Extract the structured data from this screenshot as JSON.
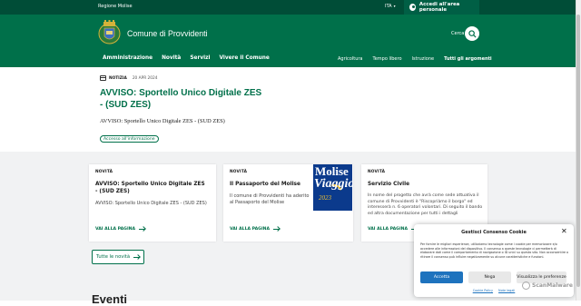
{
  "topbar": {
    "region": "Regione Molise",
    "language": "ITA",
    "login": "Accedi all'area personale"
  },
  "header": {
    "title": "Comune di Provvidenti",
    "search_label": "Cerca"
  },
  "nav": {
    "main": [
      "Amministrazione",
      "Novità",
      "Servizi",
      "Vivere il Comune"
    ],
    "secondary": [
      "Agricoltura",
      "Tempo libero",
      "Istruzione"
    ],
    "all_topics": "Tutti gli argomenti"
  },
  "featured": {
    "type": "NOTIZIA",
    "date": "20 APR 2024",
    "title": "AVVISO: Sportello Unico Digitale ZES - (SUD ZES)",
    "subtitle": "AVVISO: Sportello Unico Digitale ZES - (SUD ZES)",
    "tag": "Accesso all'informazione"
  },
  "cards": [
    {
      "category": "NOVITÀ",
      "title": "AVVISO: Sportello Unico Digitale ZES - (SUD ZES)",
      "text": "AVVISO: Sportello Unico Digitale ZES - (SUD ZES)",
      "link": "VAI ALLA PAGINA"
    },
    {
      "category": "NOVITÀ",
      "title": "Il Passaporto del Molise",
      "text": "Il comune di Provvidenti ha aderito al Passaporto del Molise",
      "link": "VAI ALLA PAGINA",
      "image_text": [
        "Molise",
        "Viaggio",
        "2023"
      ]
    },
    {
      "category": "NOVITÀ",
      "title": "Servizio Civile",
      "text": "In nome del progetto che avrà come sede attuativa il comune di Provvidenti è \"Riscopriàmo il borgo\" ed interesserà n. 6 operatori volontari. Di seguito il bando ed altra documentazione per tutti i dettagli",
      "link": "VAI ALLA PAGINA"
    }
  ],
  "all_news_button": "Tutte le novità",
  "events_heading": "Eventi",
  "consent": {
    "title": "Gestisci Consenso Cookie",
    "body": "Per fornire le migliori esperienze, utilizziamo tecnologie come i cookie per memorizzare e/o accedere alle informazioni del dispositivo. Il consenso a queste tecnologie ci permetterà di elaborare dati come il comportamento di navigazione o ID unici su questo sito. Non acconsentire o ritirare il consenso può influire negativamente su alcune caratteristiche e funzioni.",
    "accept": "Accetta",
    "deny": "Nega",
    "preferences": "Visualizza le preferenze",
    "links": [
      "Cookie Policy",
      "Note legali"
    ]
  },
  "badge": "ScanMalware",
  "colors": {
    "primary": "#00704a",
    "topbar": "#004d37",
    "consent_button": "#1e73be"
  }
}
